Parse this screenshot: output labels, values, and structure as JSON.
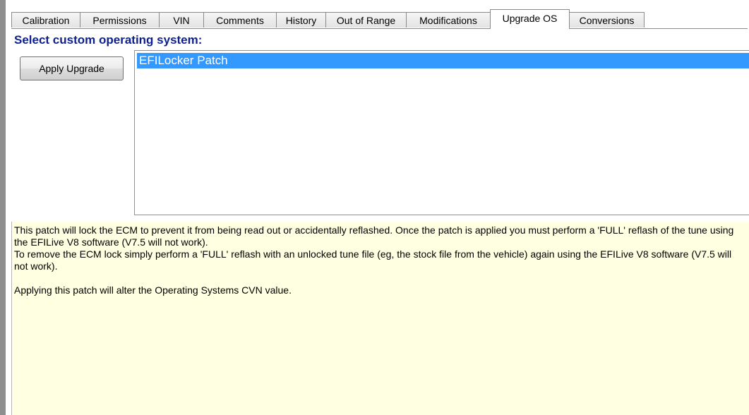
{
  "tabs": [
    {
      "label": "Calibration",
      "active": false
    },
    {
      "label": "Permissions",
      "active": false
    },
    {
      "label": "VIN",
      "active": false
    },
    {
      "label": "Comments",
      "active": false
    },
    {
      "label": "History",
      "active": false
    },
    {
      "label": "Out of Range",
      "active": false
    },
    {
      "label": "Modifications",
      "active": false
    },
    {
      "label": "Upgrade OS",
      "active": true
    },
    {
      "label": "Conversions",
      "active": false
    }
  ],
  "main": {
    "heading": "Select custom operating system:",
    "apply_button_label": "Apply Upgrade",
    "os_list": [
      {
        "label": "EFILocker Patch",
        "selected": true
      }
    ]
  },
  "description": {
    "lines": [
      "This patch will lock the ECM to prevent it from being read out or accidentally reflashed. Once the patch is applied you must perform a 'FULL' reflash of the tune using the EFILive V8 software (V7.5 will not work).",
      "To remove the ECM lock simply perform a 'FULL' reflash with an unlocked tune file (eg, the stock file from the vehicle) again using the EFILive V8 software (V7.5 will not work).",
      "",
      "Applying this patch will alter the Operating Systems CVN value."
    ]
  },
  "colors": {
    "heading": "#0c1f8f",
    "selection": "#3399ff",
    "description_bg": "#ffffe1"
  }
}
